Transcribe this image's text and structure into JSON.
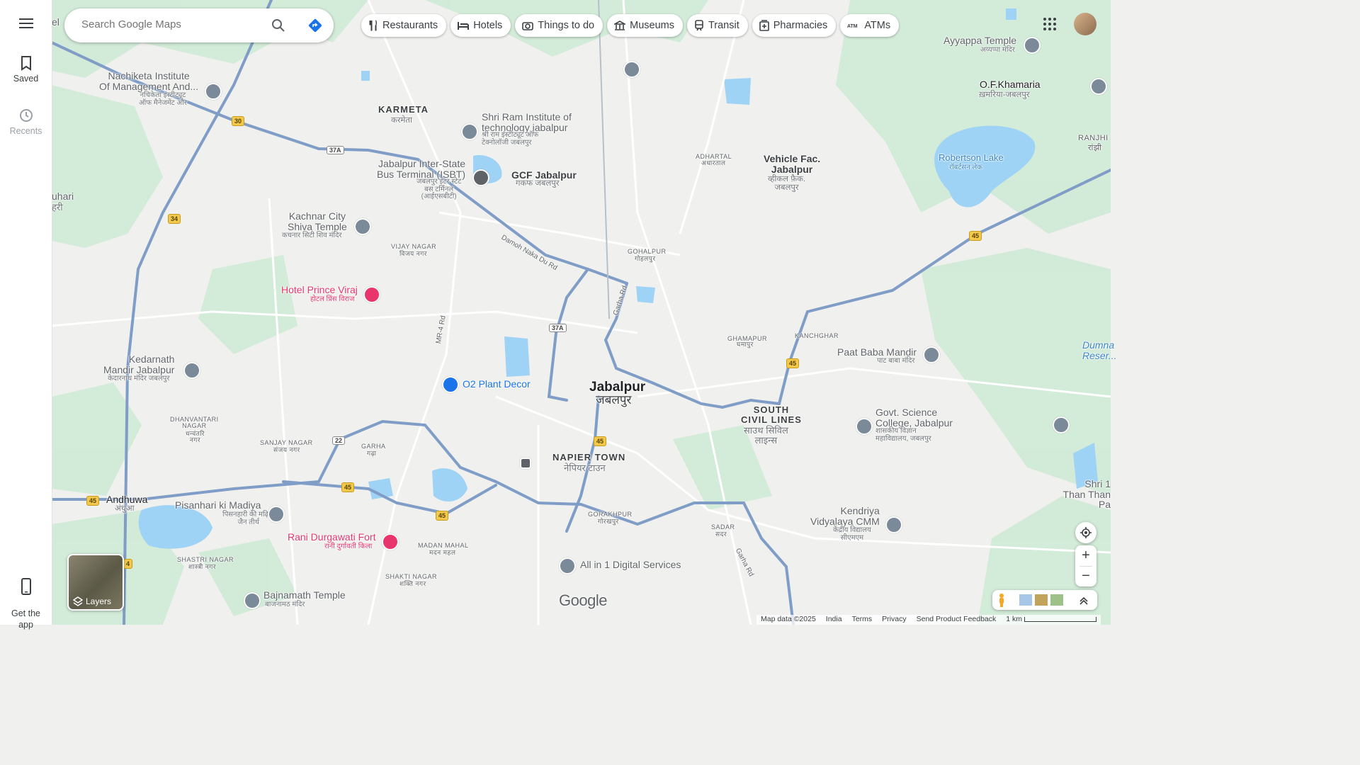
{
  "sidebar": {
    "menu_icon": "hamburger-menu-icon",
    "saved_label": "Saved",
    "recents_label": "Recents",
    "get_app_label": "Get the\napp"
  },
  "search": {
    "placeholder": "Search Google Maps",
    "search_icon": "search-icon",
    "directions_icon": "directions-icon"
  },
  "chips": [
    {
      "label": "Restaurants",
      "icon": "fork-knife-icon"
    },
    {
      "label": "Hotels",
      "icon": "bed-icon"
    },
    {
      "label": "Things to do",
      "icon": "camera-icon"
    },
    {
      "label": "Museums",
      "icon": "museum-icon"
    },
    {
      "label": "Transit",
      "icon": "train-icon"
    },
    {
      "label": "Pharmacies",
      "icon": "pharmacy-icon"
    },
    {
      "label": "ATMs",
      "icon": "atm-icon"
    }
  ],
  "labels": {
    "karmeta": "KARMETA",
    "karmeta_hi": "करमेता",
    "nachiketa": "Nachiketa Institute\nOf Management And...",
    "nachiketa_hi": "नचिकेता इंस्टीट्यूट\nऑफ मैनेजमेंट और",
    "shriram": "Shri Ram Institute of\ntechnology jabalpur",
    "shriram_hi": "श्री राम इंस्टीट्यूट ऑफ\nटेक्नोलॉजी जबलपुर",
    "isbt": "Jabalpur Inter-State\nBus Terminal (ISBT)",
    "isbt_hi": "जबलपुर इंटर स्टेट\nबस टर्मिनल\n(आईएसबीटी)",
    "gcf": "GCF Jabalpur",
    "gcf_hi": "गकफ जबलपुर",
    "adhartal": "ADHARTAL",
    "adhartal_hi": "अधारताल",
    "vehicle": "Vehicle Fac.\nJabalpur",
    "vehicle_hi": "व्हीकल फ़ैक.\nजबलपुर",
    "ayyappa": "Ayyappa Temple",
    "ayyappa_hi": "अय्यप्पा मंदिर",
    "ofk": "O.F.Khamaria",
    "ofk_hi": "ख़मरिया-जबलपुर",
    "robertson": "Robertson Lake",
    "robertson_hi": "रॉबर्टसन लेक",
    "ranjhi": "RANJHI",
    "ranjhi_hi": "रांझी",
    "kachnar": "Kachnar City\nShiva Temple",
    "kachnar_hi": "कचनार सिटी शिव मंदिर",
    "vijay": "VIJAY NAGAR",
    "vijay_hi": "विजय नगर",
    "damoh": "Damoh Naka Du Rd",
    "gohalpur": "GOHALPUR",
    "gohalpur_hi": "गोहलपुर",
    "prince": "Hotel Prince Viraj",
    "prince_hi": "होटल प्रिंस विराज",
    "mr4": "MR-4 Rd",
    "garha_rd": "Garha Rd",
    "ghamapur": "GHAMAPUR",
    "ghamapur_hi": "घमापुर",
    "kanchghar": "KANCHGHAR",
    "paatbaba": "Paat Baba Mandir",
    "paatbaba_hi": "पाट बाबा मंदिर",
    "dumna": "Dumna\nReser...",
    "kedarnath": "Kedarnath\nMandir Jabalpur",
    "kedarnath_hi": "केदारनाथ मंदिर जबलपुर",
    "o2": "O2 Plant Decor",
    "jabalpur": "Jabalpur",
    "jabalpur_hi": "जबलपुर",
    "southcl": "SOUTH\nCIVIL LINES",
    "southcl_hi": "साउथ सिविल\nलाइन्स",
    "govt": "Govt. Science\nCollege, Jabalpur",
    "govt_hi": "शासकीय विज्ञान\nमहाविद्यालय, जबलपुर",
    "dhanvantari": "DHANVANTARI\nNAGAR",
    "dhanvantari_hi": "धन्वंतरि\nनगर",
    "sanjay": "SANJAY NAGAR",
    "sanjay_hi": "संजय नगर",
    "garha": "GARHA",
    "garha_hi": "गढ़ा",
    "napier": "NAPIER TOWN",
    "napier_hi": "नेपियर टाउन",
    "andhuwa": "Andhuwa",
    "andhuwa_hi": "अंधुआ",
    "pisanhari": "Pisanhari ki Madiya",
    "pisanhari_hi": "पिसनहारी की मढ़िया\nजैन तीर्थ",
    "gorakhpur": "GORAKHPUR",
    "gorakhpur_hi": "गोरखपुर",
    "sadar": "SADAR",
    "sadar_hi": "सदर",
    "kendriya": "Kendriya\nVidyalaya CMM",
    "kendriya_hi": "केंद्रीय विद्यालय\nसीएमएम",
    "shri": "Shri 1\nThan Than Pa",
    "shastri": "SHASTRI NAGAR",
    "shastri_hi": "शास्त्री नगर",
    "rani": "Rani Durgawati Fort",
    "rani_hi": "रानी दुर्गावती किला",
    "madan": "MADAN MAHAL",
    "madan_hi": "मदन महल",
    "shakti": "SHAKTI NAGAR",
    "shakti_hi": "शक्ति नगर",
    "allin1": "All in 1 Digital Services",
    "bajnamath": "Bajnamath Temple",
    "bajnamath_hi": "बाजनामठ मंदिर",
    "bharthari": "uhari",
    "bharthari_hi": "हरी",
    "left_edge": "el",
    "google_logo": "Google"
  },
  "shields": [
    "30",
    "34",
    "37A",
    "37A",
    "45",
    "45",
    "45",
    "45",
    "45",
    "22",
    "4"
  ],
  "controls": {
    "layers_label": "Layers",
    "location_icon": "my-location-icon",
    "zoom_in": "+",
    "zoom_out": "−",
    "pegman_icon": "pegman-icon",
    "expand_icon": "chevron-up-icon"
  },
  "footer": {
    "map_data": "Map data ©2025",
    "country": "India",
    "terms": "Terms",
    "privacy": "Privacy",
    "feedback": "Send Product Feedback",
    "scale": "1 km"
  },
  "colors": {
    "land": "#f0f1ee",
    "park": "#cfead6",
    "water": "#9fd3f5",
    "road": "#7f9dc6",
    "highway_shield": "#f2c94c",
    "poi_pink": "#e8366d",
    "poi_blue": "#1a73e8"
  }
}
